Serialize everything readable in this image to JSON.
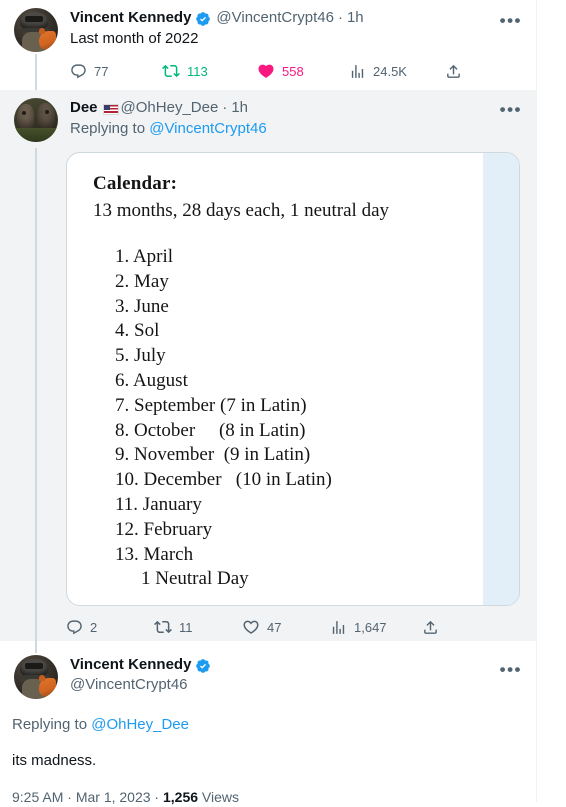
{
  "thread": {
    "tweets": [
      {
        "id": "tweet-1",
        "display_name": "Vincent Kennedy",
        "verified": true,
        "handle": "@VincentCrypt46",
        "separator": "·",
        "timestamp": "1h",
        "text": "Last month of 2022",
        "more_label": "•••",
        "actions": {
          "reply": "77",
          "retweet": "113",
          "like": "558",
          "views": "24.5K",
          "share": ""
        }
      },
      {
        "id": "tweet-2",
        "display_name": "Dee",
        "flag": "us-flag",
        "verified": false,
        "handle": "@OhHey_Dee",
        "separator": "·",
        "timestamp": "1h",
        "replying_prefix": "Replying to ",
        "replying_to": "@VincentCrypt46",
        "more_label": "•••",
        "actions": {
          "reply": "2",
          "retweet": "11",
          "like": "47",
          "views": "1,647",
          "share": ""
        }
      },
      {
        "id": "tweet-3",
        "display_name": "Vincent Kennedy",
        "verified": true,
        "handle": "@VincentCrypt46",
        "replying_prefix": "Replying to ",
        "replying_to": "@OhHey_Dee",
        "text": "its madness.",
        "more_label": "•••",
        "meta_time": "9:25 AM",
        "meta_sep1": " · ",
        "meta_date": "Mar 1, 2023",
        "meta_sep2": " · ",
        "meta_views_count": "1,256",
        "meta_views_label": " Views"
      }
    ]
  },
  "calendar_image": {
    "title": "Calendar:",
    "subtitle": "13 months, 28 days each, 1 neutral day",
    "months": [
      "1. April",
      "2. May",
      "3. June",
      "4. Sol",
      "5. July",
      "6. August",
      "7. September (7 in Latin)",
      "8. October     (8 in Latin)",
      "9. November  (9 in Latin)",
      "10. December   (10 in Latin)",
      "11. January",
      "12. February",
      "13. March"
    ],
    "neutral_day": "1 Neutral Day"
  },
  "colors": {
    "verified_blue": "#1d9bf0",
    "link_blue": "#1d9bf0",
    "retweet_green": "#00ba7c",
    "like_pink": "#f91880",
    "muted_gray": "#536471",
    "shaded_bg": "#f2f3f5",
    "card_border": "#cfd9de",
    "image_blue_strip": "#e2eef8"
  }
}
